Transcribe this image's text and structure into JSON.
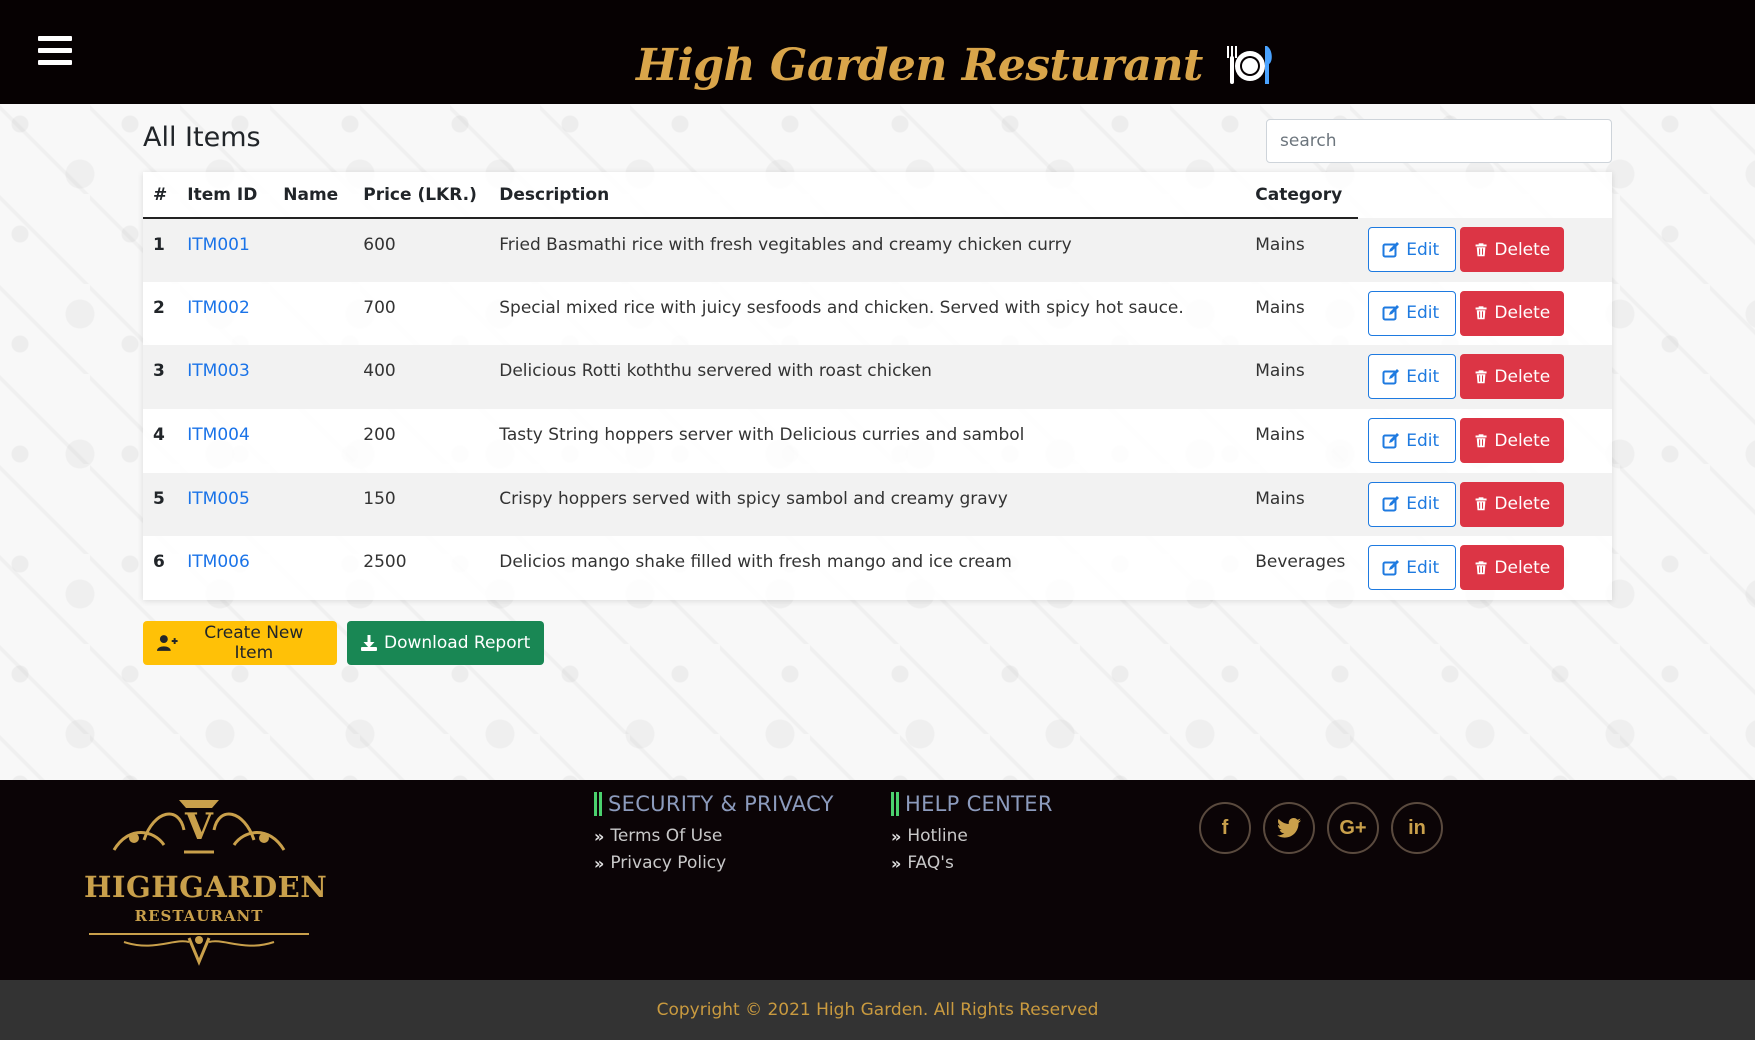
{
  "header": {
    "brand_title": "High Garden Resturant"
  },
  "main": {
    "page_title": "All Items",
    "search": {
      "placeholder": "search",
      "value": ""
    },
    "table": {
      "columns": [
        "#",
        "Item ID",
        "Name",
        "Price (LKR.)",
        "Description",
        "Category"
      ],
      "rows": [
        {
          "num": "1",
          "item_id": "ITM001",
          "name": "",
          "price": "600",
          "description": "Fried Basmathi rice with fresh vegitables and creamy chicken curry",
          "category": "Mains"
        },
        {
          "num": "2",
          "item_id": "ITM002",
          "name": "",
          "price": "700",
          "description": "Special mixed rice with juicy sesfoods and chicken. Served with spicy hot sauce.",
          "category": "Mains"
        },
        {
          "num": "3",
          "item_id": "ITM003",
          "name": "",
          "price": "400",
          "description": "Delicious Rotti koththu servered with roast chicken",
          "category": "Mains"
        },
        {
          "num": "4",
          "item_id": "ITM004",
          "name": "",
          "price": "200",
          "description": "Tasty String hoppers server with Delicious curries and sambol",
          "category": "Mains"
        },
        {
          "num": "5",
          "item_id": "ITM005",
          "name": "",
          "price": "150",
          "description": "Crispy hoppers served with spicy sambol and creamy gravy",
          "category": "Mains"
        },
        {
          "num": "6",
          "item_id": "ITM006",
          "name": "",
          "price": "2500",
          "description": "Delicios mango shake filled with fresh mango and ice cream",
          "category": "Beverages"
        }
      ],
      "edit_label": "Edit",
      "delete_label": "Delete"
    },
    "create_label": "Create New Item",
    "download_label": "Download Report"
  },
  "footer": {
    "logo": {
      "name": "HIGHGARDEN",
      "sub": "RESTAURANT",
      "crest_letter": "V"
    },
    "security": {
      "heading": "SECURITY & PRIVACY",
      "links": [
        "Terms Of Use",
        "Privacy Policy"
      ]
    },
    "help": {
      "heading": "HELP CENTER",
      "links": [
        "Hotline",
        "FAQ's"
      ]
    },
    "socials": [
      {
        "icon": "facebook-icon",
        "glyph": "f"
      },
      {
        "icon": "twitter-icon",
        "glyph": "t"
      },
      {
        "icon": "google-plus-icon",
        "glyph": "G+"
      },
      {
        "icon": "linkedin-icon",
        "glyph": "in"
      }
    ],
    "copyright": "Copyright © 2021 High Garden. All Rights Reserved"
  },
  "colors": {
    "header_bg": "#060102",
    "brand_gold": "#d9a54a",
    "edit_blue": "#1e7ae0",
    "delete_red": "#dc3545",
    "create_yellow": "#ffc107",
    "download_green": "#198754",
    "footer_heading": "#8c9bbd",
    "footer_accent": "#4bd16e"
  }
}
